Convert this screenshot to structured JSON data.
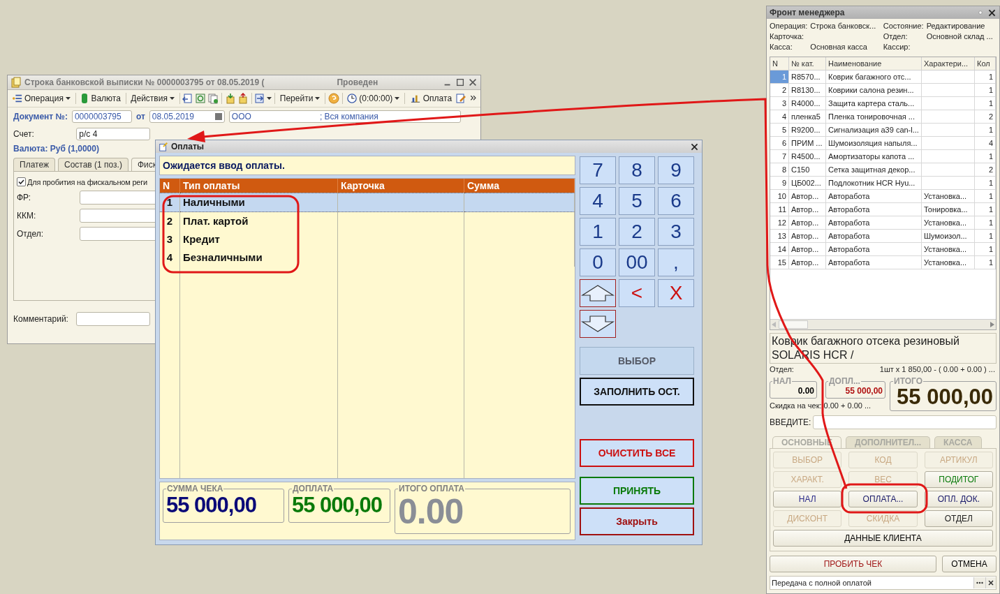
{
  "document_window": {
    "title": "Строка банковской выписки № 0000003795 от 08.05.2019 (",
    "status": "Проведен",
    "toolbar": {
      "operation": "Операция",
      "currency": "Валюта",
      "actions": "Действия",
      "goto": "Перейти",
      "timer": "(0:00:00)",
      "payment": "Оплата"
    },
    "document_label": "Документ №:",
    "document_number": "0000003795",
    "date_label": "от",
    "date": "08.05.2019",
    "organization": "ООО",
    "organization_suffix": "; Вся компания",
    "account_label": "Счет:",
    "account_value": "р/с 4",
    "currency_line": "Валюта: Руб (1,0000)",
    "tabs": [
      {
        "label": "Платеж",
        "selected": false
      },
      {
        "label": "Состав (1 поз.)",
        "selected": false
      },
      {
        "label": "Фиск",
        "selected": true
      }
    ],
    "fiscal_checkbox": {
      "label": "Для пробития на фискальном реги",
      "checked": true
    },
    "fields": [
      {
        "label": "ФР:"
      },
      {
        "label": "ККМ:"
      },
      {
        "label": "Отдел:"
      }
    ],
    "comment_label": "Комментарий:"
  },
  "payment_dialog": {
    "title": "Оплаты",
    "message": "Ожидается ввод оплаты.",
    "columns": [
      "N",
      "Тип оплаты",
      "Карточка",
      "Сумма"
    ],
    "rows": [
      {
        "n": "1",
        "type": "Наличными",
        "selected": true
      },
      {
        "n": "2",
        "type": "Плат. картой",
        "selected": false
      },
      {
        "n": "3",
        "type": "Кредит",
        "selected": false
      },
      {
        "n": "4",
        "type": "Безналичными",
        "selected": false
      }
    ],
    "totals": [
      {
        "label": "СУММА ЧЕКА",
        "value": "55 000,00",
        "color": "#0a0a78"
      },
      {
        "label": "ДОПЛАТА",
        "value": "55 000,00",
        "color": "#0a7a0a"
      },
      {
        "label": "ИТОГО ОПЛАТА",
        "value": "0.00",
        "color": "#8a8e96"
      }
    ],
    "keys": [
      {
        "kind": "text",
        "label": "7",
        "color": "#1a3a8a"
      },
      {
        "kind": "text",
        "label": "8",
        "color": "#1a3a8a"
      },
      {
        "kind": "text",
        "label": "9",
        "color": "#1a3a8a"
      },
      {
        "kind": "text",
        "label": "4",
        "color": "#1a3a8a"
      },
      {
        "kind": "text",
        "label": "5",
        "color": "#1a3a8a"
      },
      {
        "kind": "text",
        "label": "6",
        "color": "#1a3a8a"
      },
      {
        "kind": "text",
        "label": "1",
        "color": "#1a3a8a"
      },
      {
        "kind": "text",
        "label": "2",
        "color": "#1a3a8a"
      },
      {
        "kind": "text",
        "label": "3",
        "color": "#1a3a8a"
      },
      {
        "kind": "text",
        "label": "0",
        "color": "#1a3a8a"
      },
      {
        "kind": "text",
        "label": "00",
        "color": "#1a3a8a"
      },
      {
        "kind": "text",
        "label": ",",
        "color": "#1a3a8a"
      },
      {
        "kind": "arrow-up"
      },
      {
        "kind": "text",
        "label": "<",
        "color": "#cc1010"
      },
      {
        "kind": "text",
        "label": "X",
        "color": "#cc1010"
      },
      {
        "kind": "arrow-down"
      }
    ],
    "actions": [
      {
        "label": "ВЫБОР",
        "disabled": true,
        "color": "#555a66"
      },
      {
        "label": "ЗАПОЛНИТЬ ОСТ.",
        "disabled": false,
        "color": "#101010"
      },
      {
        "label": "ОЧИСТИТЬ ВСЕ",
        "disabled": false,
        "color": "#cc1010"
      },
      {
        "label": "ПРИНЯТЬ",
        "disabled": false,
        "color": "#0a7a0a"
      },
      {
        "label": "Закрыть",
        "disabled": false,
        "color": "#a01010"
      }
    ]
  },
  "manager_panel": {
    "title": "Фронт менеджера",
    "info": [
      {
        "label": "Операция:",
        "value": "Строка банковск..."
      },
      {
        "label": "Состояние:",
        "value": "Редактирование"
      },
      {
        "label": "Карточка:"
      },
      {
        "label": "Отдел:",
        "value": "Основной склад ..."
      },
      {
        "label": "Касса:",
        "value": "Основная касса"
      },
      {
        "label": "Кассир:"
      }
    ],
    "columns": [
      "N",
      "№ кат.",
      "Наименование",
      "Характери...",
      "Кол"
    ],
    "rows": [
      {
        "n": "1",
        "code": "R8570...",
        "name": "Коврик багажного отс...",
        "qty": "1",
        "selected": true
      },
      {
        "n": "2",
        "code": "R8130...",
        "name": "Коврики салона резин...",
        "qty": "1",
        "selected": false
      },
      {
        "n": "3",
        "code": "R4000...",
        "name": "Защита картера сталь...",
        "qty": "1",
        "selected": false
      },
      {
        "n": "4",
        "code": "пленка5",
        "name": "Пленка тонировочная ...",
        "qty": "2",
        "selected": false
      },
      {
        "n": "5",
        "code": "R9200...",
        "name": "Сигнализация а39 can-l...",
        "qty": "1",
        "selected": false
      },
      {
        "n": "6",
        "code": "ПРИМ ...",
        "name": "Шумоизоляция напыля...",
        "qty": "4",
        "selected": false
      },
      {
        "n": "7",
        "code": "R4500...",
        "name": "Амортизаторы капота ...",
        "qty": "1",
        "selected": false
      },
      {
        "n": "8",
        "code": "C150",
        "name": "Сетка защитная декор...",
        "qty": "2",
        "selected": false
      },
      {
        "n": "9",
        "code": "ЦБ002...",
        "name": "Подлокотник HCR Hyu...",
        "qty": "1",
        "selected": false
      },
      {
        "n": "10",
        "code": "Автор...",
        "name": "Авторабота",
        "characteristic": "Установка...",
        "qty": "1",
        "selected": false
      },
      {
        "n": "11",
        "code": "Автор...",
        "name": "Авторабота",
        "characteristic": "Тонировка...",
        "qty": "1",
        "selected": false
      },
      {
        "n": "12",
        "code": "Автор...",
        "name": "Авторабота",
        "characteristic": "Установка...",
        "qty": "1",
        "selected": false
      },
      {
        "n": "13",
        "code": "Автор...",
        "name": "Авторабота",
        "characteristic": "Шумоизол...",
        "qty": "1",
        "selected": false
      },
      {
        "n": "14",
        "code": "Автор...",
        "name": "Авторабота",
        "characteristic": "Установка...",
        "qty": "1",
        "selected": false
      },
      {
        "n": "15",
        "code": "Автор...",
        "name": "Авторабота",
        "characteristic": "Установка...",
        "qty": "1",
        "selected": false
      }
    ],
    "product_name": "Коврик багажного отсека резиновый SOLARIS HCR /",
    "department_label": "Отдел:",
    "price_line": "1шт x 1 850,00 - ( 0.00 + 0.00 ) ...",
    "sums": [
      {
        "label": "НАЛ",
        "value": "0.00",
        "color": "#000000"
      },
      {
        "label": "ДОПЛ...",
        "value": "55 000,00",
        "color": "#b01010"
      }
    ],
    "total": {
      "label": "ИТОГО",
      "value": "55 000,00"
    },
    "discount_line": "Скидка на чек: 0.00 + 0.00 ...",
    "input_label": "ВВЕДИТЕ:",
    "tabs": [
      {
        "label": "ОСНОВНЫЕ",
        "selected": true
      },
      {
        "label": "ДОПОЛНИТЕЛ...",
        "selected": false
      },
      {
        "label": "КАССА",
        "selected": false
      }
    ],
    "buttons": [
      {
        "label": "ВЫБОР",
        "disabled": true,
        "color": "#c8a882"
      },
      {
        "label": "КОД",
        "disabled": true,
        "color": "#c8a882"
      },
      {
        "label": "АРТИКУЛ",
        "disabled": true,
        "color": "#c8a882"
      },
      {
        "label": "ХАРАКТ.",
        "disabled": true,
        "color": "#c8a882"
      },
      {
        "label": "ВЕС",
        "disabled": true,
        "color": "#c8a882"
      },
      {
        "label": "ПОДИТОГ",
        "disabled": false,
        "color": "#0a7a0a"
      },
      {
        "label": "НАЛ",
        "disabled": false,
        "color": "#2a2a8a"
      },
      {
        "label": "ОПЛАТА...",
        "disabled": false,
        "color": "#1a1a6a"
      },
      {
        "label": "ОПЛ. ДОК.",
        "disabled": false,
        "color": "#1a1a6a"
      },
      {
        "label": "ДИСКОНТ",
        "disabled": true,
        "color": "#c8a882"
      },
      {
        "label": "СКИДКА",
        "disabled": true,
        "color": "#c8a882"
      },
      {
        "label": "ОТДЕЛ",
        "disabled": false,
        "color": "#202020"
      }
    ],
    "client_button": "ДАННЫЕ КЛИЕНТА",
    "print_button": "ПРОБИТЬ ЧЕК",
    "cancel_button": "ОТМЕНА",
    "mode_field": "Передача с полной оплатой"
  }
}
